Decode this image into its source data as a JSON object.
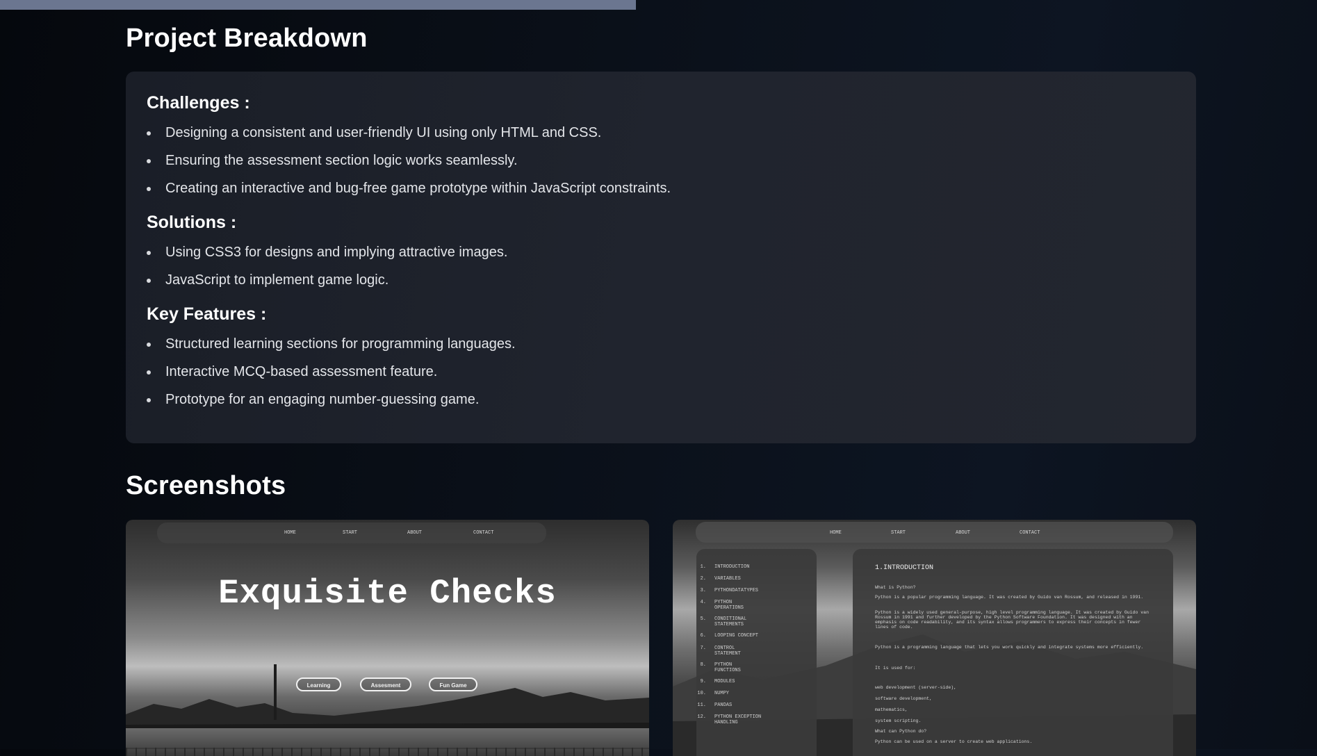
{
  "breakdown": {
    "title": "Project Breakdown",
    "challenges": {
      "heading": "Challenges :",
      "items": [
        "Designing a consistent and user-friendly UI using only HTML and CSS.",
        "Ensuring the assessment section logic works seamlessly.",
        "Creating an interactive and bug-free game prototype within JavaScript constraints."
      ]
    },
    "solutions": {
      "heading": "Solutions :",
      "items": [
        "Using CSS3 for designs and implying attractive images.",
        "JavaScript to implement game logic."
      ]
    },
    "features": {
      "heading": "Key Features :",
      "items": [
        "Structured learning sections for programming languages.",
        "Interactive MCQ-based assessment feature.",
        "Prototype for an engaging number-guessing game."
      ]
    }
  },
  "screenshots": {
    "title": "Screenshots",
    "shot1": {
      "nav": [
        "HOME",
        "START",
        "ABOUT",
        "CONTACT"
      ],
      "hero_title": "Exquisite Checks",
      "buttons": [
        "Learning",
        "Assesment",
        "Fun Game"
      ]
    },
    "shot2": {
      "nav": [
        "HOME",
        "START",
        "ABOUT",
        "CONTACT"
      ],
      "toc": [
        {
          "num": "1.",
          "text": "INTRODUCTION"
        },
        {
          "num": "2.",
          "text": "VARIABLES"
        },
        {
          "num": "3.",
          "text": "PYTHONDATATYPES"
        },
        {
          "num": "4.",
          "text": "PYTHON OPERATIONS"
        },
        {
          "num": "5.",
          "text": "CONDITIONAL STATEMENTS"
        },
        {
          "num": "6.",
          "text": "LOOPING CONCEPT"
        },
        {
          "num": "7.",
          "text": "CONTROL STATEMENT"
        },
        {
          "num": "8.",
          "text": "PYTHON FUNCTIONS"
        },
        {
          "num": "9.",
          "text": "MODULES"
        },
        {
          "num": "10.",
          "text": "NUMPY"
        },
        {
          "num": "11.",
          "text": "PANDAS"
        },
        {
          "num": "12.",
          "text": "PYTHON EXCEPTION HANDLING"
        }
      ],
      "content_heading": "1.INTRODUCTION",
      "content_lines": [
        "What is Python?",
        "Python is a popular programming language. It was created by Guido van Rossum, and released in 1991.",
        "Python is a widely used general-purpose, high level programming language. It was created by Guido van Rossum in 1991 and further developed by the Python Software Foundation. It was designed with an emphasis on code readability, and its syntax allows programmers to express their concepts in fewer lines of code.",
        "Python is a programming language that lets you work quickly and integrate systems more efficiently.",
        "It is used for:",
        "web development (server-side),",
        "software development,",
        "mathematics,",
        "system scripting.",
        "What can Python do?",
        "Python can be used on a server to create web applications."
      ]
    }
  }
}
